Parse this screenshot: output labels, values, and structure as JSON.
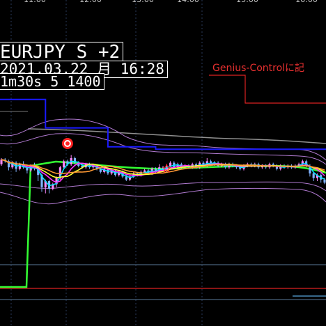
{
  "header": {
    "symbol": "EURJPY S +2",
    "datetime": "2021.03.22 月 16:28",
    "info": "1m30s 5 1400"
  },
  "annotation": {
    "genius_label": "Genius-Controlに記"
  },
  "colors": {
    "background": "#000000",
    "bull_candle": "#ff88ff",
    "bear_candle": "#7fb2ff",
    "ma_fast": "#00e5ff",
    "ma_mid": "#ffff33",
    "ma_slow": "#ff9933",
    "ma_green": "#33ff33",
    "ma_magenta": "#ff33ff",
    "upper_step": "#1a1aff",
    "red_step": "#dd2222",
    "bands": "#b07ad0",
    "grey_line": "#909090",
    "signal_star": "#ff2222"
  },
  "chart_data": {
    "type": "candlestick",
    "title": "EURJPY S +2",
    "x_time_labels": [
      "11:00",
      "12:00",
      "13:00",
      "14:00",
      "15:00",
      "16:00"
    ],
    "candles": [
      {
        "o": 0.1,
        "c": 0.4,
        "h": 0.5,
        "l": 0.0
      },
      {
        "o": 0.4,
        "c": 0.3,
        "h": 0.5,
        "l": 0.2
      },
      {
        "o": 0.3,
        "c": -0.1,
        "h": 0.4,
        "l": -0.3
      },
      {
        "o": -0.1,
        "c": 0.2,
        "h": 0.3,
        "l": -0.2
      },
      {
        "o": 0.2,
        "c": -0.2,
        "h": 0.3,
        "l": -0.4
      },
      {
        "o": -0.2,
        "c": 0.1,
        "h": 0.2,
        "l": -0.3
      },
      {
        "o": 0.1,
        "c": -0.1,
        "h": 0.3,
        "l": -0.2
      },
      {
        "o": -0.1,
        "c": -0.3,
        "h": 0.1,
        "l": -0.5
      },
      {
        "o": -0.3,
        "c": 0.0,
        "h": 0.1,
        "l": -0.4
      },
      {
        "o": 0.0,
        "c": -0.1,
        "h": 0.2,
        "l": -0.3
      },
      {
        "o": -0.1,
        "c": -0.6,
        "h": 0.0,
        "l": -1.0
      },
      {
        "o": -0.6,
        "c": -1.4,
        "h": -0.5,
        "l": -1.7
      },
      {
        "o": -1.4,
        "c": -1.0,
        "h": -0.9,
        "l": -1.8
      },
      {
        "o": -1.0,
        "c": -1.5,
        "h": -0.9,
        "l": -1.8
      },
      {
        "o": -1.5,
        "c": -1.2,
        "h": -1.1,
        "l": -1.6
      },
      {
        "o": -1.2,
        "c": -0.8,
        "h": -0.7,
        "l": -1.4
      },
      {
        "o": -0.8,
        "c": -0.1,
        "h": 0.0,
        "l": -0.9
      },
      {
        "o": -0.1,
        "c": 0.3,
        "h": 0.4,
        "l": -0.2
      },
      {
        "o": 0.3,
        "c": 0.1,
        "h": 0.4,
        "l": 0.0
      },
      {
        "o": 0.1,
        "c": 0.5,
        "h": 0.7,
        "l": 0.0
      },
      {
        "o": 0.5,
        "c": 0.2,
        "h": 0.6,
        "l": 0.1
      },
      {
        "o": 0.2,
        "c": 0.0,
        "h": 0.3,
        "l": -0.1
      },
      {
        "o": 0.0,
        "c": -0.1,
        "h": 0.1,
        "l": -0.2
      },
      {
        "o": -0.1,
        "c": 0.1,
        "h": 0.2,
        "l": -0.2
      },
      {
        "o": 0.1,
        "c": -0.1,
        "h": 0.2,
        "l": -0.2
      },
      {
        "o": -0.1,
        "c": 0.0,
        "h": 0.1,
        "l": -0.2
      },
      {
        "o": 0.0,
        "c": -0.2,
        "h": 0.1,
        "l": -0.3
      },
      {
        "o": -0.2,
        "c": -0.4,
        "h": -0.1,
        "l": -0.5
      },
      {
        "o": -0.4,
        "c": -0.2,
        "h": -0.1,
        "l": -0.5
      },
      {
        "o": -0.2,
        "c": -0.5,
        "h": -0.1,
        "l": -0.6
      },
      {
        "o": -0.5,
        "c": -0.3,
        "h": -0.2,
        "l": -0.6
      },
      {
        "o": -0.3,
        "c": -0.6,
        "h": -0.2,
        "l": -0.7
      },
      {
        "o": -0.6,
        "c": -0.4,
        "h": -0.3,
        "l": -0.7
      },
      {
        "o": -0.4,
        "c": -0.7,
        "h": -0.3,
        "l": -0.8
      },
      {
        "o": -0.7,
        "c": -0.9,
        "h": -0.6,
        "l": -1.0
      },
      {
        "o": -0.9,
        "c": -0.7,
        "h": -0.6,
        "l": -1.0
      },
      {
        "o": -0.7,
        "c": -0.5,
        "h": -0.4,
        "l": -0.8
      },
      {
        "o": -0.5,
        "c": -0.6,
        "h": -0.4,
        "l": -0.7
      },
      {
        "o": -0.6,
        "c": -0.4,
        "h": -0.3,
        "l": -0.7
      },
      {
        "o": -0.4,
        "c": -0.3,
        "h": -0.2,
        "l": -0.5
      },
      {
        "o": -0.3,
        "c": -0.5,
        "h": -0.2,
        "l": -0.6
      },
      {
        "o": -0.5,
        "c": -0.2,
        "h": -0.1,
        "l": -0.6
      },
      {
        "o": -0.2,
        "c": -0.4,
        "h": -0.1,
        "l": -0.5
      },
      {
        "o": -0.4,
        "c": -0.1,
        "h": 0.1,
        "l": -0.5
      },
      {
        "o": -0.1,
        "c": -0.3,
        "h": 0.0,
        "l": -0.4
      },
      {
        "o": -0.3,
        "c": 0.0,
        "h": 0.1,
        "l": -0.4
      },
      {
        "o": 0.0,
        "c": 0.2,
        "h": 0.3,
        "l": -0.1
      },
      {
        "o": 0.2,
        "c": -0.1,
        "h": 0.3,
        "l": -0.2
      },
      {
        "o": -0.1,
        "c": 0.1,
        "h": 0.2,
        "l": -0.2
      },
      {
        "o": 0.1,
        "c": -0.1,
        "h": 0.2,
        "l": -0.2
      },
      {
        "o": -0.1,
        "c": 0.0,
        "h": 0.1,
        "l": -0.2
      },
      {
        "o": 0.0,
        "c": -0.1,
        "h": 0.1,
        "l": -0.2
      },
      {
        "o": -0.1,
        "c": 0.1,
        "h": 0.2,
        "l": -0.2
      },
      {
        "o": 0.1,
        "c": -0.1,
        "h": 0.2,
        "l": -0.2
      },
      {
        "o": -0.1,
        "c": 0.2,
        "h": 0.3,
        "l": -0.2
      },
      {
        "o": 0.2,
        "c": 0.0,
        "h": 0.3,
        "l": -0.1
      },
      {
        "o": 0.0,
        "c": 0.3,
        "h": 0.5,
        "l": -0.1
      },
      {
        "o": 0.3,
        "c": 0.1,
        "h": 0.4,
        "l": 0.0
      },
      {
        "o": 0.1,
        "c": 0.2,
        "h": 0.3,
        "l": 0.0
      },
      {
        "o": 0.2,
        "c": 0.0,
        "h": 0.3,
        "l": -0.1
      },
      {
        "o": 0.0,
        "c": 0.1,
        "h": 0.2,
        "l": -0.1
      },
      {
        "o": 0.1,
        "c": -0.1,
        "h": 0.2,
        "l": -0.2
      },
      {
        "o": -0.1,
        "c": 0.1,
        "h": 0.2,
        "l": -0.2
      },
      {
        "o": 0.1,
        "c": 0.0,
        "h": 0.2,
        "l": -0.1
      },
      {
        "o": 0.0,
        "c": -0.1,
        "h": 0.1,
        "l": -0.2
      },
      {
        "o": -0.1,
        "c": -0.2,
        "h": 0.0,
        "l": -0.3
      },
      {
        "o": -0.2,
        "c": 0.0,
        "h": 0.1,
        "l": -0.3
      },
      {
        "o": 0.0,
        "c": 0.1,
        "h": 0.2,
        "l": -0.1
      },
      {
        "o": 0.1,
        "c": 0.0,
        "h": 0.2,
        "l": -0.1
      },
      {
        "o": 0.0,
        "c": 0.1,
        "h": 0.2,
        "l": -0.1
      },
      {
        "o": 0.1,
        "c": -0.1,
        "h": 0.2,
        "l": -0.2
      },
      {
        "o": -0.1,
        "c": 0.0,
        "h": 0.1,
        "l": -0.2
      },
      {
        "o": 0.0,
        "c": -0.1,
        "h": 0.1,
        "l": -0.2
      },
      {
        "o": -0.1,
        "c": 0.1,
        "h": 0.2,
        "l": -0.2
      },
      {
        "o": 0.1,
        "c": 0.0,
        "h": 0.2,
        "l": -0.1
      },
      {
        "o": 0.0,
        "c": -0.2,
        "h": 0.1,
        "l": -0.3
      },
      {
        "o": -0.2,
        "c": 0.0,
        "h": 0.1,
        "l": -0.3
      },
      {
        "o": 0.0,
        "c": -0.1,
        "h": 0.1,
        "l": -0.2
      },
      {
        "o": -0.1,
        "c": 0.0,
        "h": 0.1,
        "l": -0.2
      },
      {
        "o": 0.0,
        "c": -0.1,
        "h": 0.1,
        "l": -0.2
      },
      {
        "o": -0.1,
        "c": 0.0,
        "h": 0.1,
        "l": -0.2
      },
      {
        "o": 0.0,
        "c": 0.1,
        "h": 0.2,
        "l": -0.1
      },
      {
        "o": 0.1,
        "c": 0.3,
        "h": 0.4,
        "l": 0.0
      },
      {
        "o": 0.3,
        "c": 0.0,
        "h": 0.4,
        "l": -0.1
      },
      {
        "o": 0.0,
        "c": -0.5,
        "h": 0.1,
        "l": -0.7
      },
      {
        "o": -0.5,
        "c": -0.8,
        "h": -0.4,
        "l": -1.0
      },
      {
        "o": -0.8,
        "c": -0.6,
        "h": -0.5,
        "l": -1.0
      },
      {
        "o": -0.6,
        "c": -0.9,
        "h": -0.5,
        "l": -1.1
      },
      {
        "o": -0.9,
        "c": -1.1,
        "h": -0.8,
        "l": -1.2
      }
    ],
    "upper_step_line": [
      {
        "from": 0,
        "to": 12,
        "v": 2.8
      },
      {
        "from": 12,
        "to": 29,
        "v": 1.6
      },
      {
        "from": 29,
        "to": 42,
        "v": 0.8
      },
      {
        "from": 42,
        "to": 89,
        "v": 0.7
      }
    ],
    "signal_markers": [
      {
        "index": 18,
        "kind": "sell-star"
      },
      {
        "index": 45,
        "kind": "buy-star"
      }
    ]
  }
}
